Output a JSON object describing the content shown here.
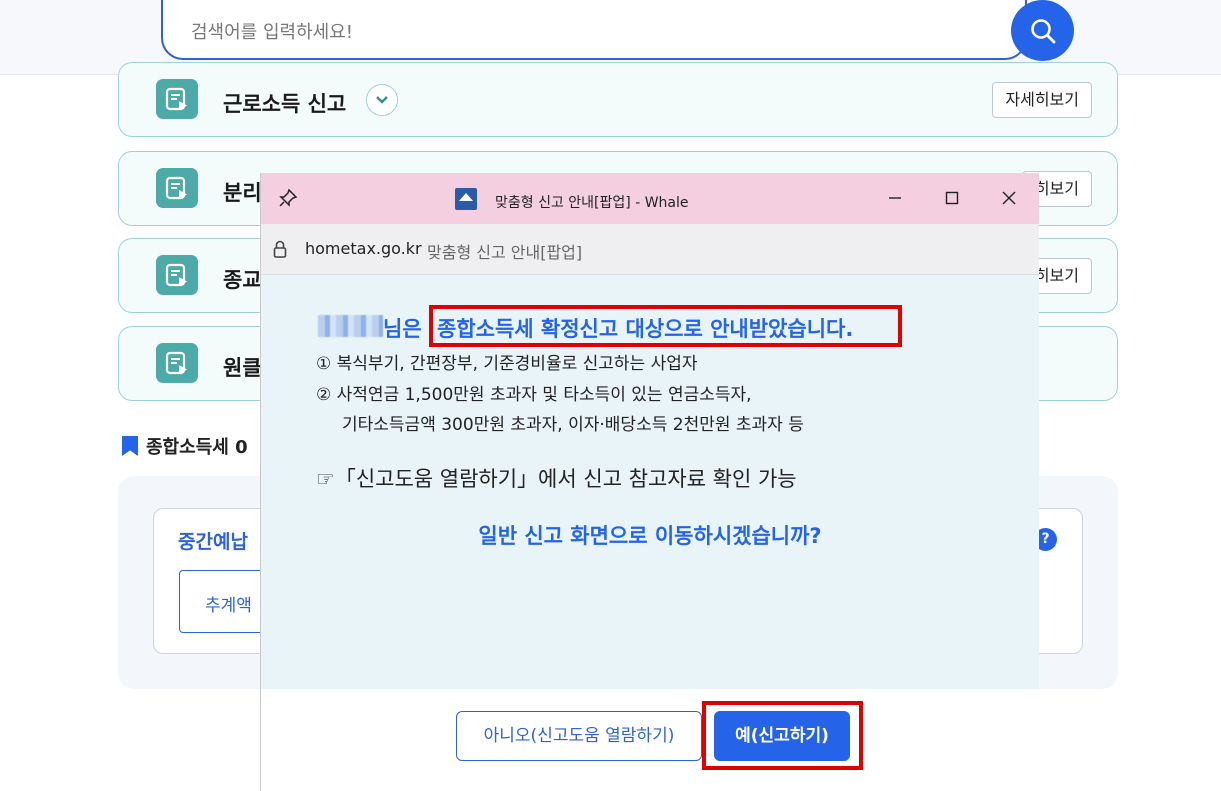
{
  "search": {
    "placeholder": "검색어를 입력하세요!"
  },
  "cards": [
    {
      "title": "근로소득 신고",
      "more_label": "자세히보기"
    },
    {
      "title": "분리",
      "more_label": "히보기"
    },
    {
      "title": "종교",
      "more_label": "히보기"
    },
    {
      "title": "원클"
    }
  ],
  "section": {
    "label": "종합소득세 0"
  },
  "panel": {
    "title": "중간예납",
    "button_label": "추계액",
    "help": "?"
  },
  "popup": {
    "window_title": "맞춤형 신고 안내[팝업] - Whale",
    "address_domain": "hometax.go.kr",
    "address_title": "맞춤형 신고 안내[팝업]",
    "name_suffix": "님은",
    "headline": "종합소득세 확정신고 대상으로 안내받았습니다.",
    "lines": [
      "① 복식부기, 간편장부, 기준경비율로 신고하는 사업자",
      "② 사적연금 1,500만원 초과자 및 타소득이 있는 연금소득자,",
      "기타소득금액 300만원 초과자, 이자·배당소득 2천만원 초과자 등"
    ],
    "help_line": "☞「신고도움 열람하기」에서 신고 참고자료 확인 가능",
    "question": "일반 신고 화면으로 이동하시겠습니까?",
    "btn_no": "아니오(신고도움 열람하기)",
    "btn_yes": "예(신고하기)"
  },
  "colors": {
    "accent": "#2563e8",
    "highlight": "#e00000",
    "teal": "#4daaa8"
  }
}
